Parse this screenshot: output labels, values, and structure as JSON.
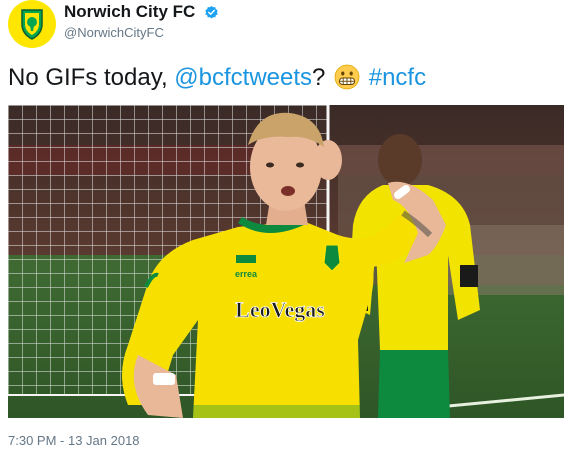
{
  "tweet": {
    "display_name": "Norwich City FC",
    "handle": "@NorwichCityFC",
    "text_before": "No GIFs today, ",
    "mention": "@bcfctweets",
    "text_after": "? ",
    "hashtag": "#ncfc",
    "timestamp": "7:30 PM - 13 Jan 2018",
    "verified": true
  },
  "photo": {
    "shirt_sponsor": "LeoVegas",
    "shirt_brand": "errea"
  },
  "icons": {
    "avatar": "norwich-crest-icon",
    "verified": "verified-badge-icon",
    "emoji": "grimacing-face-icon"
  },
  "colors": {
    "link": "#1b95e0",
    "verified": "#1da1f2",
    "club_yellow": "#ffe600",
    "club_green": "#00a650",
    "muted_text": "#657786"
  }
}
